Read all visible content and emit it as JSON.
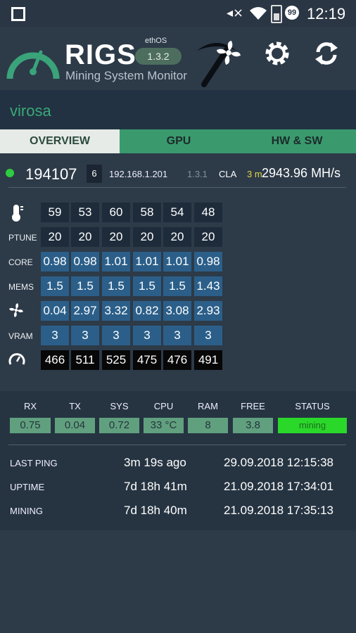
{
  "status_bar": {
    "time": "12:19",
    "notification_count": "99",
    "icons": [
      "square-icon",
      "mute-icon",
      "wifi-icon",
      "battery-icon"
    ]
  },
  "header": {
    "title": "RIGS",
    "subtitle": "Mining System Monitor",
    "os_label": "ethOS",
    "os_version": "1.3.2",
    "icons": [
      "gauge-icon",
      "pickaxe-icon",
      "fan-icon",
      "settings-icon",
      "refresh-icon"
    ]
  },
  "rig_name": "virosa",
  "tabs": [
    "OVERVIEW",
    "GPU",
    "HW & SW"
  ],
  "summary": {
    "rig_id": "194107",
    "gpu_count": "6",
    "ip": "192.168.1.201",
    "version": "1.3.1",
    "miner": "CLA",
    "uptime_short": "3 m",
    "hashrate": "2943.96 MH/s"
  },
  "gpu_grid": {
    "rows": [
      {
        "label": "",
        "icon": "thermometer-icon",
        "style": "dark",
        "values": [
          "59",
          "53",
          "60",
          "58",
          "54",
          "48"
        ]
      },
      {
        "label": "PTUNE",
        "icon": "",
        "style": "dark",
        "values": [
          "20",
          "20",
          "20",
          "20",
          "20",
          "20"
        ]
      },
      {
        "label": "CORE",
        "icon": "",
        "style": "blue",
        "values": [
          "0.98",
          "0.98",
          "1.01",
          "1.01",
          "1.01",
          "0.98"
        ]
      },
      {
        "label": "MEMS",
        "icon": "",
        "style": "blue",
        "values": [
          "1.5",
          "1.5",
          "1.5",
          "1.5",
          "1.5",
          "1.43"
        ]
      },
      {
        "label": "",
        "icon": "fan-icon",
        "style": "blue",
        "values": [
          "0.04",
          "2.97",
          "3.32",
          "0.82",
          "3.08",
          "2.93"
        ]
      },
      {
        "label": "VRAM",
        "icon": "",
        "style": "blue",
        "values": [
          "3",
          "3",
          "3",
          "3",
          "3",
          "3"
        ]
      },
      {
        "label": "",
        "icon": "speedometer-icon",
        "style": "black",
        "values": [
          "466",
          "511",
          "525",
          "475",
          "476",
          "491"
        ]
      }
    ]
  },
  "stats": {
    "headers": [
      "RX",
      "TX",
      "SYS",
      "CPU",
      "RAM",
      "FREE",
      "STATUS"
    ],
    "values": [
      "0.75",
      "0.04",
      "0.72",
      "33 °C",
      "8",
      "3.8",
      "mining"
    ]
  },
  "info": [
    {
      "label": "LAST PING",
      "duration": "3m 19s  ago",
      "date": "29.09.2018 12:15:38"
    },
    {
      "label": "UPTIME",
      "duration": "7d 18h 41m",
      "date": "21.09.2018 17:34:01"
    },
    {
      "label": "MINING",
      "duration": "7d 18h 40m",
      "date": "21.09.2018 17:35:13"
    }
  ],
  "colors": {
    "background": "#2d3a48",
    "accent_green": "#3a9a6e",
    "status_green": "#2ad82a",
    "cell_blue": "#2b5f89"
  }
}
